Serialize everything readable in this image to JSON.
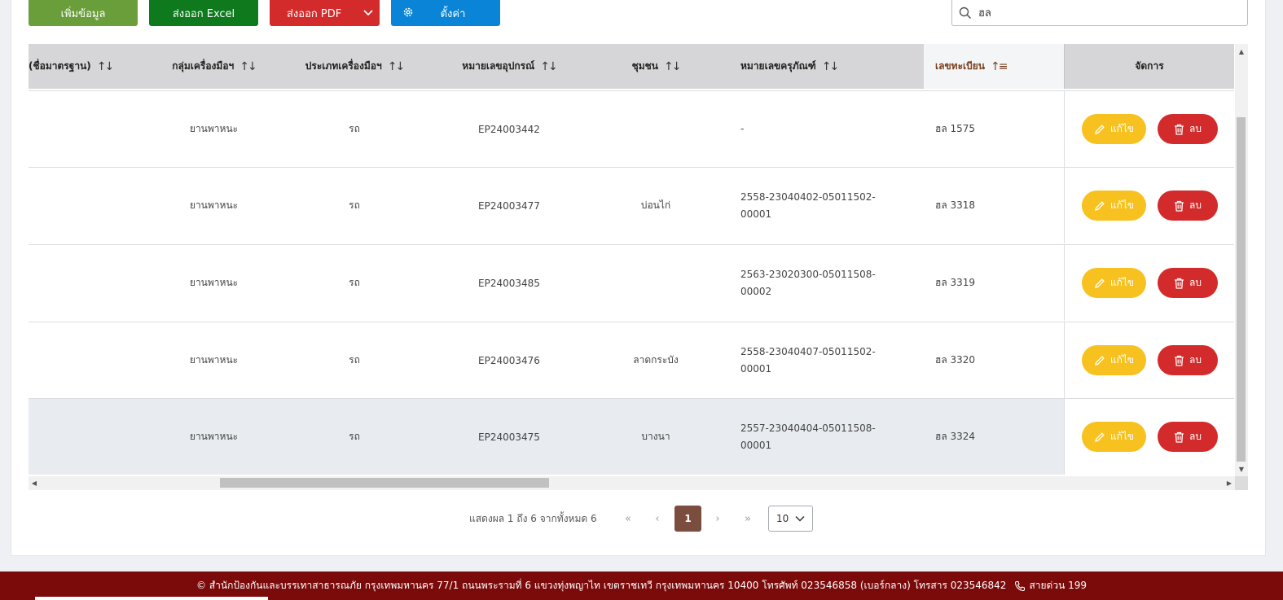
{
  "toolbar": {
    "add_label": "เพิ่มข้อมูล",
    "excel_label": "ส่งออก Excel",
    "pdf_label": "ส่งออก PDF",
    "settings_label": "ตั้งค่า"
  },
  "search": {
    "value": "ฮล"
  },
  "table": {
    "columns": [
      "(ชื่อมาตรฐาน)",
      "กลุ่มเครื่องมือฯ",
      "ประเภทเครื่องมือฯ",
      "หมายเลขอุปกรณ์",
      "ชุมชน",
      "หมายเลขครุภัณฑ์",
      "เลขทะเบียน",
      "จัดการ"
    ],
    "rows": [
      {
        "group": "ยานพาหนะ",
        "type": "รถ",
        "equipment_no": "EP24003442",
        "community": "",
        "asset_no": "-",
        "registration": "ฮล 1575"
      },
      {
        "group": "ยานพาหนะ",
        "type": "รถ",
        "equipment_no": "EP24003477",
        "community": "บ่อนไก่",
        "asset_no": "2558-23040402-05011502-\n00001",
        "registration": "ฮล 3318"
      },
      {
        "group": "ยานพาหนะ",
        "type": "รถ",
        "equipment_no": "EP24003485",
        "community": "",
        "asset_no": "2563-23020300-05011508-\n00002",
        "registration": "ฮล 3319"
      },
      {
        "group": "ยานพาหนะ",
        "type": "รถ",
        "equipment_no": "EP24003476",
        "community": "ลาดกระบัง",
        "asset_no": "2558-23040407-05011502-\n00001",
        "registration": "ฮล 3320"
      },
      {
        "group": "ยานพาหนะ",
        "type": "รถ",
        "equipment_no": "EP24003475",
        "community": "บางนา",
        "asset_no": "2557-23040404-05011508-\n00001",
        "registration": "ฮล 3324"
      }
    ],
    "edit_label": "แก้ไข",
    "delete_label": "ลบ"
  },
  "pagination": {
    "info": "แสดงผล 1 ถึง 6 จากทั้งหมด 6",
    "current_page": "1",
    "page_size": "10"
  },
  "footer": {
    "text": "© สำนักป้องกันและบรรเทาสาธารณภัย กรุงเทพมหานคร 77/1 ถนนพระรามที่ 6 แขวงทุ่งพญาไท เขตราชเทวี กรุงเทพมหานคร 10400 โทรศัพท์ 023546858 (เบอร์กลาง) โทรสาร 023546842",
    "hotline": "สายด่วน 199"
  },
  "colors": {
    "add": "#6a9e3a",
    "excel": "#0f7a1d",
    "pdf": "#d32b2b",
    "settings": "#0a84d6",
    "edit": "#f7c21f",
    "delete": "#d32b2b",
    "page_active": "#7a4d3e",
    "footer": "#7b0a0a"
  },
  "icons": [
    "chevron-down-icon",
    "gear-icon",
    "search-icon",
    "sort-icon",
    "sort-asc-icon",
    "pencil-icon",
    "trash-icon",
    "first-page-icon",
    "prev-page-icon",
    "next-page-icon",
    "last-page-icon",
    "phone-icon"
  ]
}
